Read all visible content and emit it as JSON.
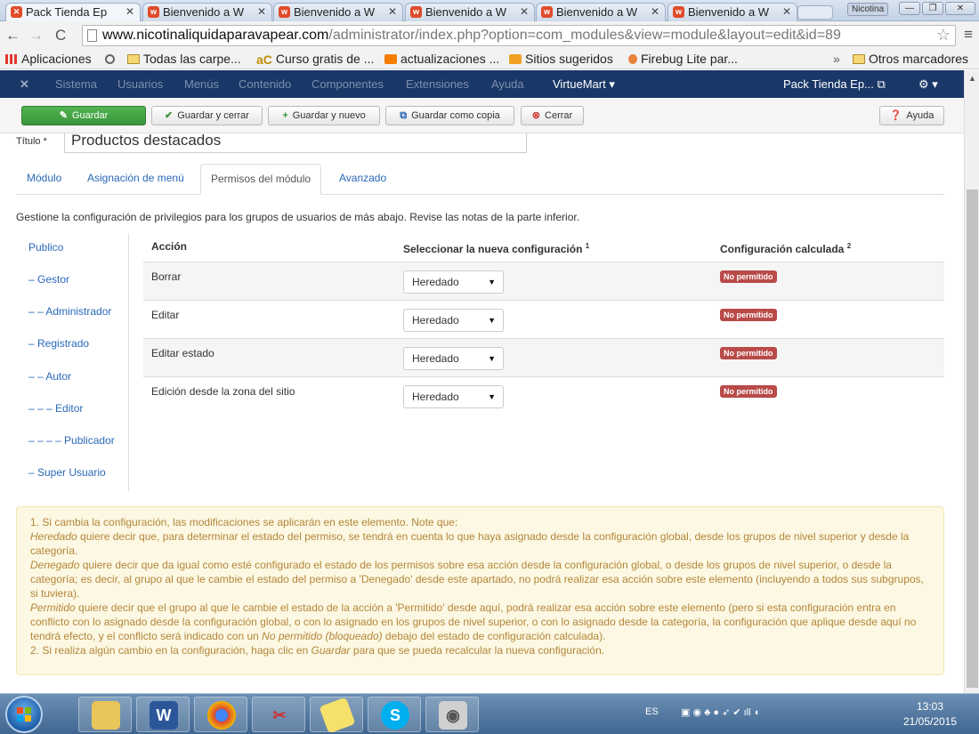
{
  "browser": {
    "tabs": [
      {
        "title": "Pack Tienda Ep",
        "active": true
      },
      {
        "title": "Bienvenido a W"
      },
      {
        "title": "Bienvenido a W"
      },
      {
        "title": "Bienvenido a W"
      },
      {
        "title": "Bienvenido a W"
      },
      {
        "title": "Bienvenido a W"
      }
    ],
    "user_badge": "Nicotina",
    "url_domain": "www.nicotinaliquidaparavapear.com",
    "url_path": "/administrator/index.php?option=com_modules&view=module&layout=edit&id=89",
    "bookmarks": [
      "Aplicaciones",
      "Todas las carpe...",
      "Curso gratis de ...",
      "actualizaciones ...",
      "Sitios sugeridos",
      "Firebug Lite par..."
    ],
    "bookmarks_overflow": "»",
    "other_bookmarks": "Otros marcadores"
  },
  "admin_nav": {
    "items": [
      "Sistema",
      "Usuarios",
      "Menús",
      "Contenido",
      "Componentes",
      "Extensiones",
      "Ayuda"
    ],
    "virtuemart": "VirtueMart ▾",
    "site_name": "Pack Tienda Ep... ⧉",
    "settings_caret": "⚙ ▾"
  },
  "toolbar": {
    "save": "Guardar",
    "save_close": "Guardar y cerrar",
    "save_new": "Guardar y nuevo",
    "save_copy": "Guardar como copia",
    "close": "Cerrar",
    "help": "Ayuda"
  },
  "form": {
    "title_label": "Título *",
    "title_value": "Productos destacados",
    "tabs": [
      "Módulo",
      "Asignación de menú",
      "Permisos del módulo",
      "Avanzado"
    ],
    "active_tab": "Permisos del módulo",
    "intro": "Gestione la configuración de privilegios para los grupos de usuarios de más abajo. Revise las notas de la parte inferior."
  },
  "groups": [
    "Publico",
    "– Gestor",
    "– – Administrador",
    "– Registrado",
    "– – Autor",
    "– – – Editor",
    "– – – – Publicador",
    "– Super Usuario"
  ],
  "permissions": {
    "headers": {
      "action": "Acción",
      "new_setting": "Seleccionar la nueva configuración",
      "new_setting_sup": "1",
      "calculated": "Configuración calculada",
      "calculated_sup": "2"
    },
    "rows": [
      {
        "action": "Borrar",
        "setting": "Heredado",
        "calculated": "No permitido"
      },
      {
        "action": "Editar",
        "setting": "Heredado",
        "calculated": "No permitido"
      },
      {
        "action": "Editar estado",
        "setting": "Heredado",
        "calculated": "No permitido"
      },
      {
        "action": "Edición desde la zona del sitio",
        "setting": "Heredado",
        "calculated": "No permitido"
      }
    ]
  },
  "notes": {
    "n1": "1. Si cambia la configuración, las modificaciones se aplicarán en este elemento. Note que:",
    "heredado_term": "Heredado",
    "heredado_text": " quiere decir que, para determinar el estado del permiso, se tendrá en cuenta lo que haya asignado desde la configuración global, desde los grupos de nivel superior y desde la categoría.",
    "denegado_term": "Denegado",
    "denegado_text": " quiere decir que da igual como esté configurado el estado de los permisos sobre esa acción desde la configuración global, o desde los grupos de nivel superior, o desde la categoría; es decir, al grupo al que le cambie el estado del permiso a 'Denegado' desde este apartado, no podrá realizar esa acción sobre este elemento (incluyendo a todos sus subgrupos, si tuviera).",
    "permitido_term": "Permitido",
    "permitido_text": " quiere decir que el grupo al que le cambie el estado de la acción a 'Permitido' desde aquí, podrá realizar esa acción sobre este elemento (pero si esta configuración entra en conflicto con lo asignado desde la configuración global, o con lo asignado en los grupos de nivel superior, o con lo asignado desde la categoría, la configuración que aplique desde aquí no tendrá efecto, y el conflicto será indicado con un ",
    "permitido_em": "No permitido (bloqueado)",
    "permitido_tail": " debajo del estado de configuración calculada).",
    "n2_pre": "2. Si realiza algún cambio en la configuración, haga clic en ",
    "n2_em": "Guardar",
    "n2_post": " para que se pueda recalcular la nueva configuración."
  },
  "taskbar": {
    "language": "ES",
    "time": "13:03",
    "date": "21/05/2015"
  }
}
